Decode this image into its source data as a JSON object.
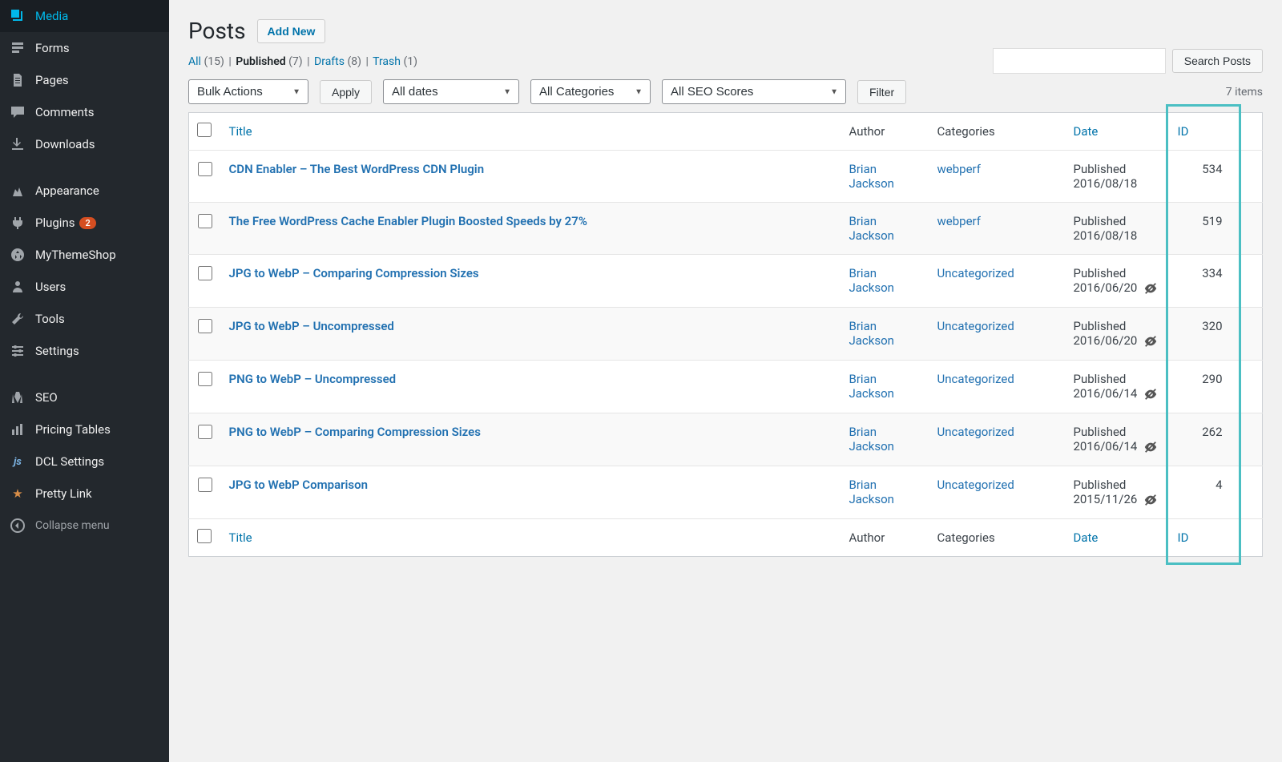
{
  "sidebar": {
    "items": [
      {
        "label": "Media",
        "icon": "media"
      },
      {
        "label": "Forms",
        "icon": "forms"
      },
      {
        "label": "Pages",
        "icon": "pages"
      },
      {
        "label": "Comments",
        "icon": "comments"
      },
      {
        "label": "Downloads",
        "icon": "downloads"
      },
      {
        "gap": true
      },
      {
        "label": "Appearance",
        "icon": "appearance"
      },
      {
        "label": "Plugins",
        "icon": "plugins",
        "badge": "2"
      },
      {
        "label": "MyThemeShop",
        "icon": "mythemeshop"
      },
      {
        "label": "Users",
        "icon": "users"
      },
      {
        "label": "Tools",
        "icon": "tools"
      },
      {
        "label": "Settings",
        "icon": "settings"
      },
      {
        "gap": true
      },
      {
        "label": "SEO",
        "icon": "seo"
      },
      {
        "label": "Pricing Tables",
        "icon": "pricing"
      },
      {
        "label": "DCL Settings",
        "icon": "dcl"
      },
      {
        "label": "Pretty Link",
        "icon": "prettylink"
      }
    ],
    "collapse_label": "Collapse menu"
  },
  "header": {
    "title": "Posts",
    "add_new": "Add New"
  },
  "filters": {
    "all_label": "All",
    "all_count": "(15)",
    "published_label": "Published",
    "published_count": "(7)",
    "drafts_label": "Drafts",
    "drafts_count": "(8)",
    "trash_label": "Trash",
    "trash_count": "(1)"
  },
  "controls": {
    "bulk_actions": "Bulk Actions",
    "apply": "Apply",
    "all_dates": "All dates",
    "all_categories": "All Categories",
    "all_seo": "All SEO Scores",
    "filter": "Filter",
    "items_count": "7 items",
    "search_btn": "Search Posts"
  },
  "table": {
    "headers": {
      "title": "Title",
      "author": "Author",
      "categories": "Categories",
      "date": "Date",
      "id": "ID"
    },
    "rows": [
      {
        "title": "CDN Enabler – The Best WordPress CDN Plugin",
        "author": "Brian Jackson",
        "category": "webperf",
        "status": "Published",
        "date": "2016/08/18",
        "id": "534",
        "eye": false
      },
      {
        "title": "The Free WordPress Cache Enabler Plugin Boosted Speeds by 27%",
        "author": "Brian Jackson",
        "category": "webperf",
        "status": "Published",
        "date": "2016/08/18",
        "id": "519",
        "eye": false
      },
      {
        "title": "JPG to WebP – Comparing Compression Sizes",
        "author": "Brian Jackson",
        "category": "Uncategorized",
        "status": "Published",
        "date": "2016/06/20",
        "id": "334",
        "eye": true
      },
      {
        "title": "JPG to WebP – Uncompressed",
        "author": "Brian Jackson",
        "category": "Uncategorized",
        "status": "Published",
        "date": "2016/06/20",
        "id": "320",
        "eye": true
      },
      {
        "title": "PNG to WebP – Uncompressed",
        "author": "Brian Jackson",
        "category": "Uncategorized",
        "status": "Published",
        "date": "2016/06/14",
        "id": "290",
        "eye": true
      },
      {
        "title": "PNG to WebP – Comparing Compression Sizes",
        "author": "Brian Jackson",
        "category": "Uncategorized",
        "status": "Published",
        "date": "2016/06/14",
        "id": "262",
        "eye": true
      },
      {
        "title": "JPG to WebP Comparison",
        "author": "Brian Jackson",
        "category": "Uncategorized",
        "status": "Published",
        "date": "2015/11/26",
        "id": "4",
        "eye": true
      }
    ]
  }
}
